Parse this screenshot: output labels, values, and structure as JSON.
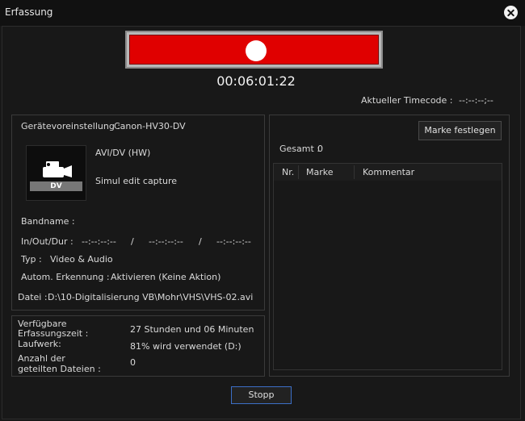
{
  "window": {
    "title": "Erfassung"
  },
  "recorder": {
    "timecode": "00:06:01:22",
    "current_timecode_label": "Aktueller Timecode :",
    "current_timecode_value": "--:--:--;--"
  },
  "device": {
    "preset_label": "Gerätevoreinstellung :",
    "preset_value": "Canon-HV30-DV",
    "icon_label": "DV",
    "format": "AVI/DV (HW)",
    "mode": "Simul edit capture",
    "tape_name_label": "Bandname :",
    "in_out_dur_label": "In/Out/Dur :",
    "in_value": "--:--:--:--",
    "out_value": "--:--:--:--",
    "dur_value": "--:--:--:--",
    "separator": "/",
    "type_label": "Typ :",
    "type_value": "Video & Audio",
    "autodetect_label": "Autom. Erkennung :",
    "autodetect_value": "Aktivieren (Keine Aktion)",
    "file_label": "Datei :",
    "file_value": "D:\\10-Digitalisierung VB\\Mohr\\VHS\\VHS-02.avi"
  },
  "status": {
    "available_label_line1": "Verfügbare",
    "available_label_line2": "Erfassungszeit :",
    "available_value": "27 Stunden und 06 Minuten",
    "drive_label": "Laufwerk:",
    "drive_value": "81% wird verwendet (D:)",
    "split_label_line1": "Anzahl der",
    "split_label_line2": "geteilten Dateien :",
    "split_value": "0"
  },
  "markers": {
    "set_button": "Marke festlegen",
    "total_label": "Gesamt :",
    "total_value": "0",
    "columns": [
      "Nr.",
      "Marke",
      "Kommentar"
    ]
  },
  "footer": {
    "stop_button": "Stopp"
  }
}
